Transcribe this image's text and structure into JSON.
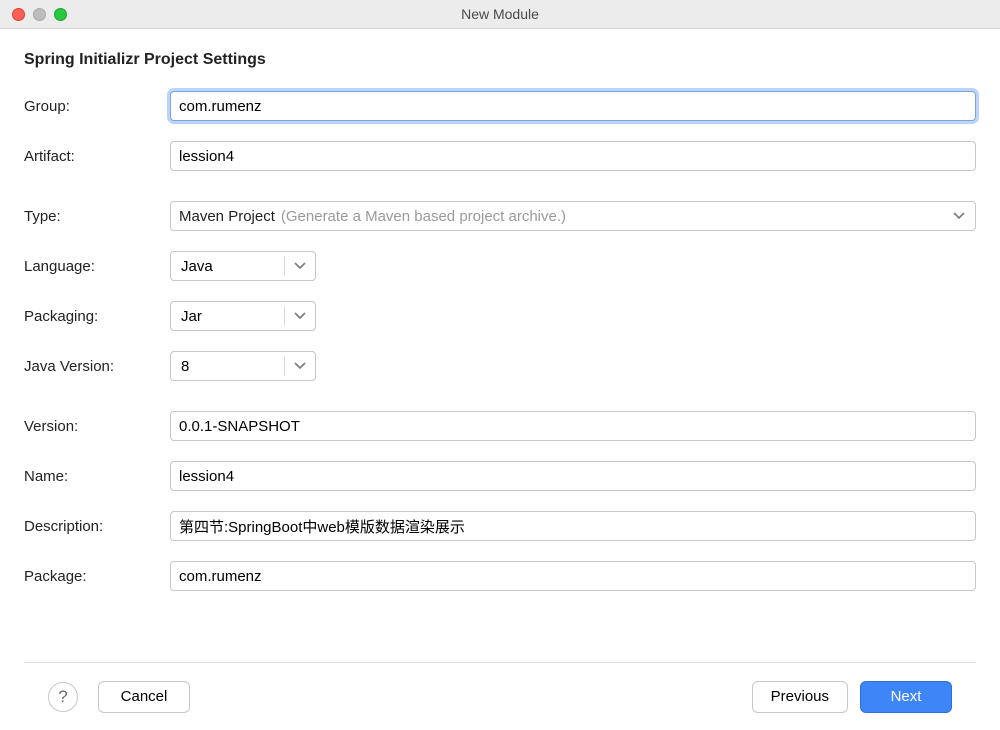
{
  "window": {
    "title": "New Module"
  },
  "heading": "Spring Initializr Project Settings",
  "labels": {
    "group": "Group:",
    "artifact": "Artifact:",
    "type": "Type:",
    "language": "Language:",
    "packaging": "Packaging:",
    "javaVersion": "Java Version:",
    "version": "Version:",
    "name": "Name:",
    "description": "Description:",
    "package": "Package:"
  },
  "values": {
    "group": "com.rumenz",
    "artifact": "lession4",
    "typeMain": "Maven Project",
    "typeHint": "(Generate a Maven based project archive.)",
    "language": "Java",
    "packaging": "Jar",
    "javaVersion": "8",
    "version": "0.0.1-SNAPSHOT",
    "name": "lession4",
    "description": "第四节:SpringBoot中web模版数据渲染展示",
    "package": "com.rumenz"
  },
  "buttons": {
    "help": "?",
    "cancel": "Cancel",
    "previous": "Previous",
    "next": "Next"
  }
}
